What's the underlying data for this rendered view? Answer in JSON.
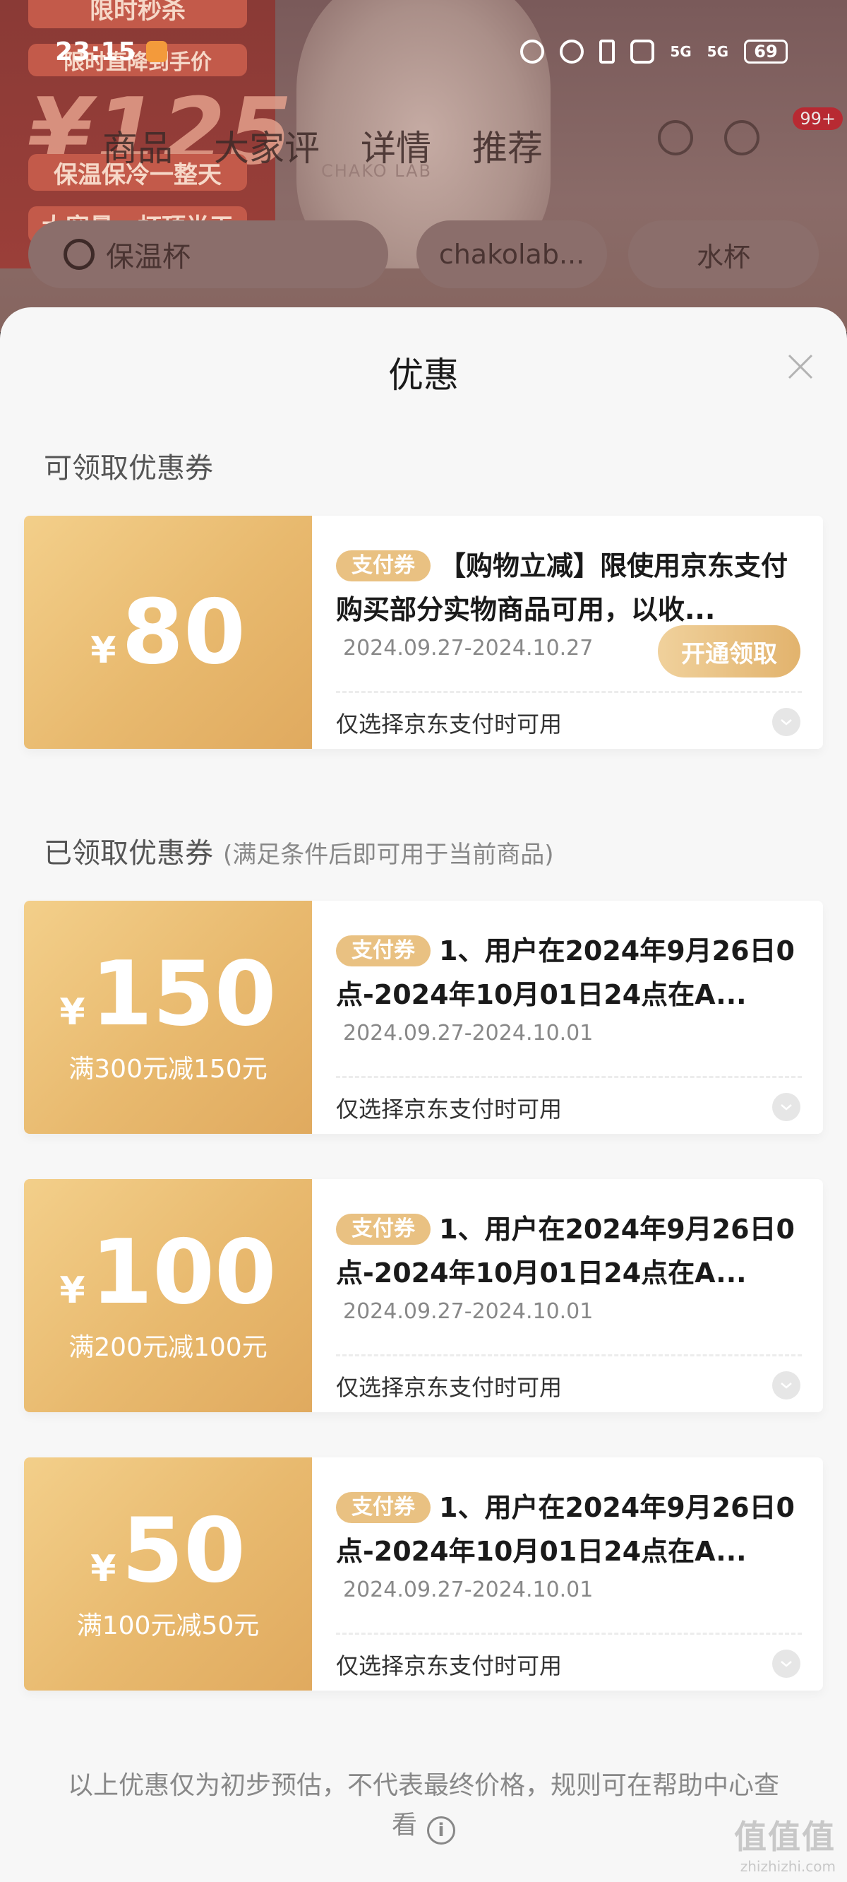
{
  "status_bar": {
    "time": "23:15",
    "signal1": "5G",
    "signal2": "5G",
    "battery": "69"
  },
  "background": {
    "promo_tags": [
      "限时秒杀",
      "限时直降到手价",
      "保温保冷一整天",
      "大容量一杯顶半天"
    ],
    "promo_price": "¥125",
    "cup_brand": "CHAKO LAB",
    "nav_tabs": [
      "商品",
      "大家评",
      "详情",
      "推荐"
    ],
    "cart_badge": "99+",
    "search_text": "保温杯",
    "chips": [
      "chakolab...",
      "水杯"
    ]
  },
  "sheet": {
    "title": "优惠",
    "available_section": "可领取优惠券",
    "claimed_section": "已领取优惠券",
    "claimed_section_sub": "(满足条件后即可用于当前商品)",
    "disclaimer": "以上优惠仅为初步预估，不代表最终价格，规则可在帮助中心查看"
  },
  "coupons": [
    {
      "yen": "¥",
      "amount": "80",
      "condition": "",
      "tag": "支付券",
      "description": "【购物立减】限使用京东支付购买部分实物商品可用，以收...",
      "date": "2024.09.27-2024.10.27",
      "action": "开通领取",
      "footer": "仅选择京东支付时可用"
    },
    {
      "yen": "¥",
      "amount": "150",
      "condition": "满300元减150元",
      "tag": "支付券",
      "description": "1、用户在2024年9月26日0点-2024年10月01日24点在A...",
      "date": "2024.09.27-2024.10.01",
      "footer": "仅选择京东支付时可用"
    },
    {
      "yen": "¥",
      "amount": "100",
      "condition": "满200元减100元",
      "tag": "支付券",
      "description": "1、用户在2024年9月26日0点-2024年10月01日24点在A...",
      "date": "2024.09.27-2024.10.01",
      "footer": "仅选择京东支付时可用"
    },
    {
      "yen": "¥",
      "amount": "50",
      "condition": "满100元减50元",
      "tag": "支付券",
      "description": "1、用户在2024年9月26日0点-2024年10月01日24点在A...",
      "date": "2024.09.27-2024.10.01",
      "footer": "仅选择京东支付时可用"
    }
  ],
  "watermark": {
    "logo": "值值值",
    "url": "zhizhizhi.com"
  },
  "colors": {
    "coupon_gold": "#e8b96e",
    "tag_gold": "#e9c182",
    "sheet_bg": "#f7f7f7"
  }
}
